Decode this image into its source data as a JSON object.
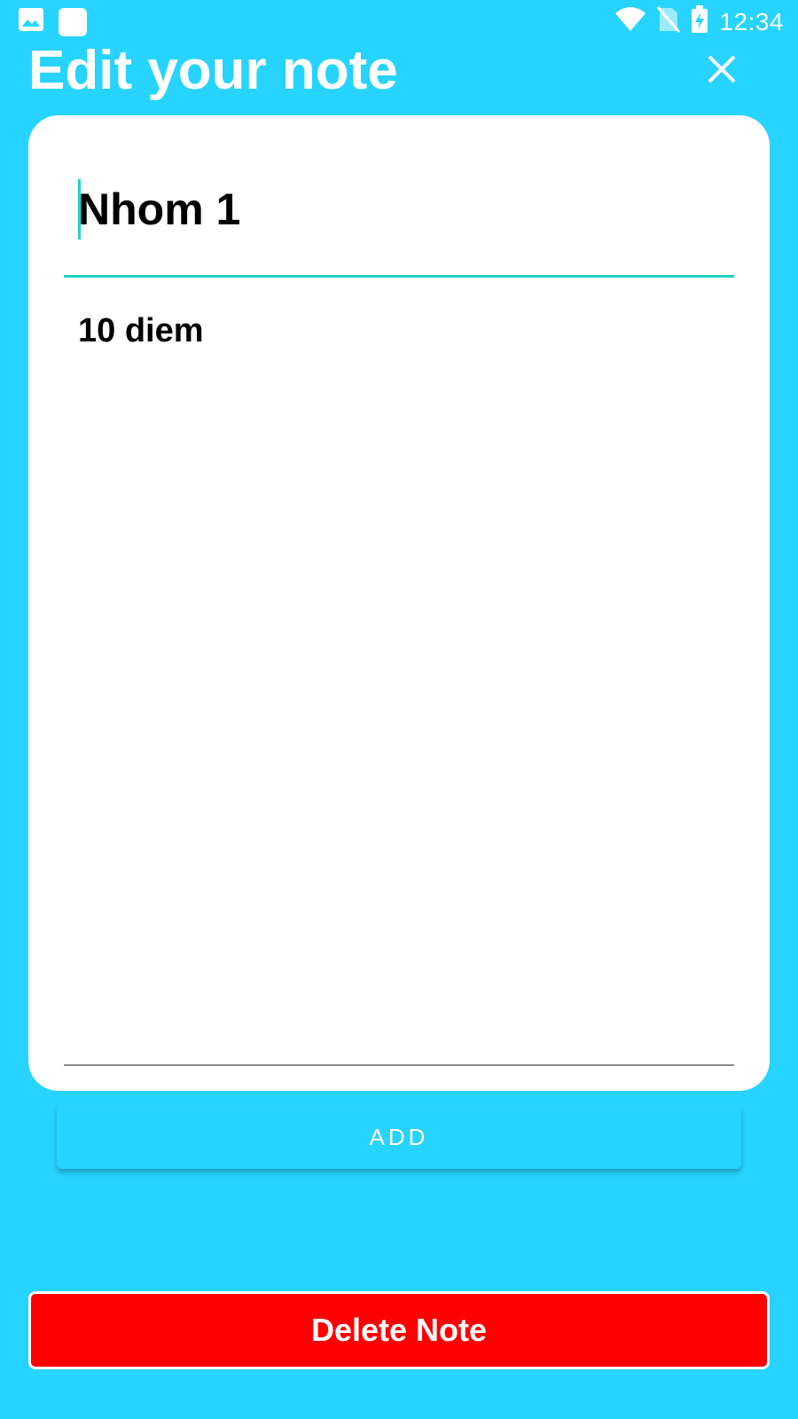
{
  "status_bar": {
    "time": "12:34",
    "icons": [
      "image-icon",
      "app-icon",
      "wifi-icon",
      "no-sim-icon",
      "battery-charging-icon"
    ]
  },
  "header": {
    "title": "Edit your note",
    "close_icon": "close-icon"
  },
  "note": {
    "title_value": "Nhom 1",
    "body_value": "10 diem"
  },
  "buttons": {
    "add_label": "ADD",
    "delete_label": "Delete Note"
  },
  "colors": {
    "background": "#27d3ff",
    "accent_underline": "#1fd1c9",
    "delete": "#ff0000",
    "card": "#ffffff"
  }
}
